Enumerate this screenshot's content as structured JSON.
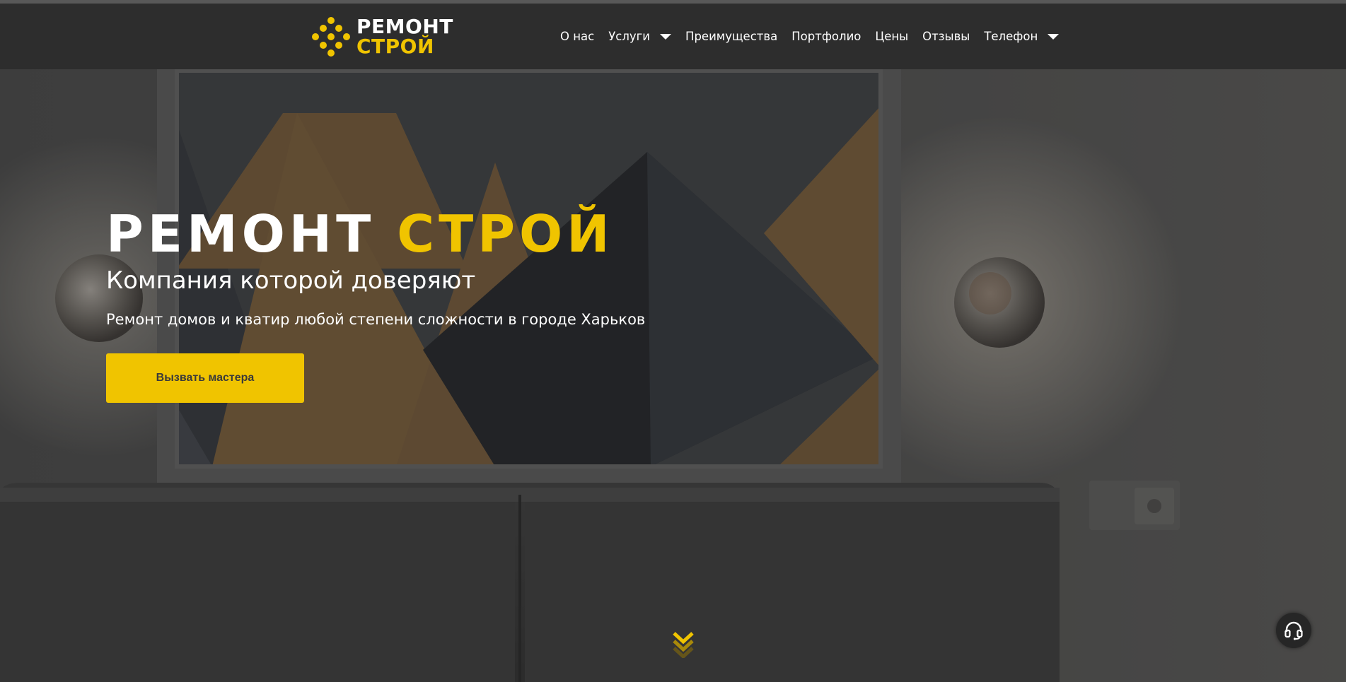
{
  "brand": {
    "name_line1": "РЕМОНТ",
    "name_line2": "СТРОЙ",
    "accent_color": "#f0c400",
    "logo_icon": "dots-cluster-logo-icon"
  },
  "nav": {
    "items": [
      {
        "label": "О нас",
        "has_dropdown": false
      },
      {
        "label": "Услуги",
        "has_dropdown": true
      },
      {
        "label": "Преимущества",
        "has_dropdown": false
      },
      {
        "label": "Портфолио",
        "has_dropdown": false
      },
      {
        "label": "Цены",
        "has_dropdown": false
      },
      {
        "label": "Отзывы",
        "has_dropdown": false
      },
      {
        "label": "Телефон",
        "has_dropdown": true
      }
    ]
  },
  "hero": {
    "title_word1": "РЕМОНТ",
    "title_word2": "СТРОЙ",
    "subtitle": "Компания которой доверяют",
    "description": "Ремонт домов и кватир любой степени сложности в городе Харьков",
    "cta_label": "Вызвать мастера"
  },
  "widgets": {
    "scroll_icon": "double-chevron-down-icon",
    "support_icon": "headset-icon"
  },
  "colors": {
    "header_bg": "#2d2d2d",
    "accent": "#f0c400",
    "text": "#ffffff"
  }
}
